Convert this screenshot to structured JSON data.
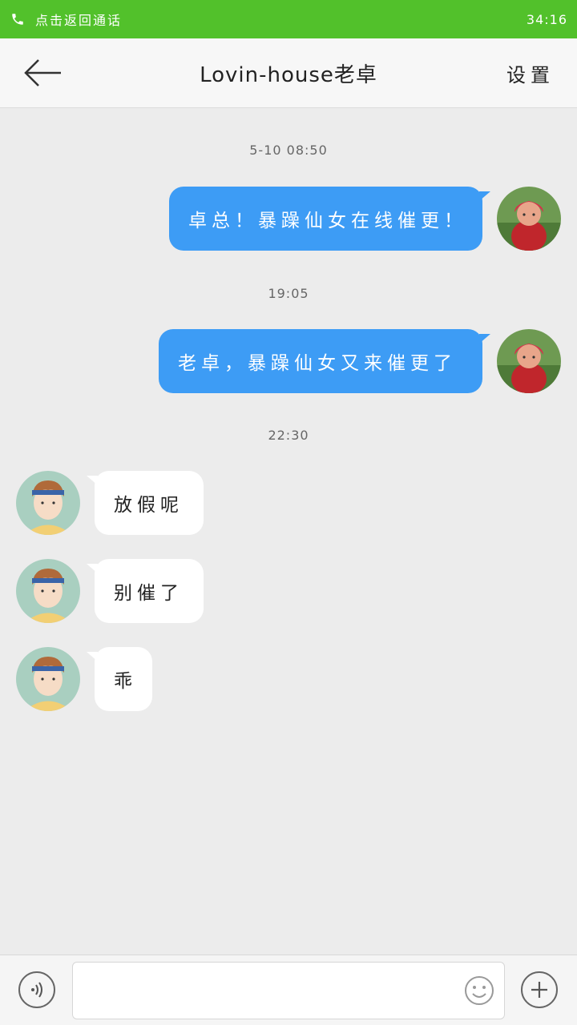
{
  "status_bar": {
    "call_text": "点击返回通话",
    "time": "34:16",
    "icon": "phone-icon",
    "color": "#52c12b"
  },
  "nav": {
    "back_icon": "arrow-left-icon",
    "title": "Lovin-house老卓",
    "settings_label": "设置"
  },
  "messages": {
    "ts1": "5-10 08:50",
    "m1": "卓总！暴躁仙女在线催更！",
    "ts2": "19:05",
    "m2": "老卓，暴躁仙女又来催更了",
    "ts3": "22:30",
    "m3": "放假呢",
    "m4": "别催了",
    "m5": "乖"
  },
  "input_bar": {
    "voice_icon": "voice-icon",
    "text_value": "",
    "emoji_icon": "smiley-icon",
    "plus_icon": "plus-icon"
  },
  "colors": {
    "outgoing_bubble": "#3d9cf5",
    "incoming_bubble": "#ffffff",
    "chat_background": "#ececec"
  }
}
